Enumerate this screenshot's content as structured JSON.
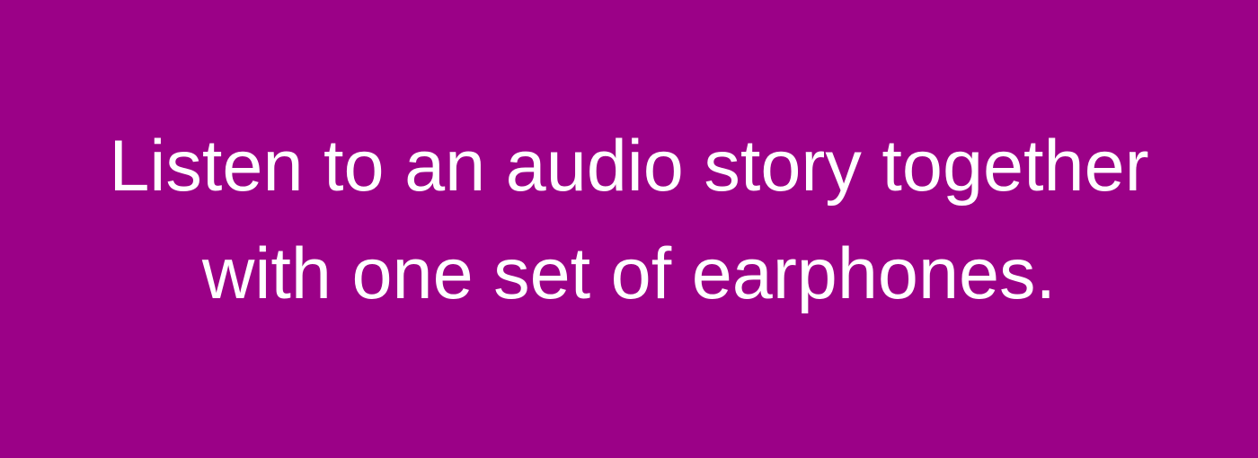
{
  "banner": {
    "background_color": "#9b0187",
    "text_color": "#ffffff",
    "lines": [
      "Listen to an audio story together",
      "with one set of earphones."
    ]
  }
}
